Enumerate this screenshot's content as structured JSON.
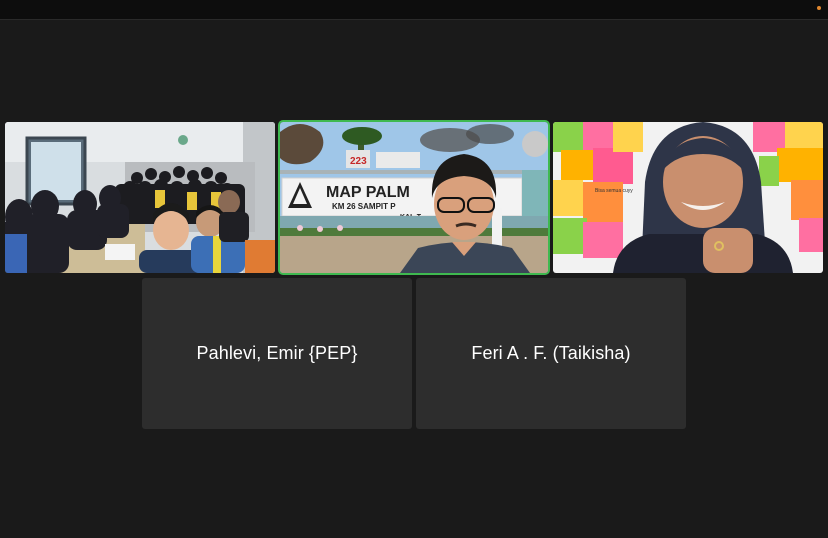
{
  "window": {
    "recording_indicator_color": "#e0872f"
  },
  "participants": [
    {
      "type": "video",
      "description_icon": "group-video-icon"
    },
    {
      "type": "video",
      "active_speaker": true,
      "sign_text_1": "MAP PALM",
      "sign_text_2": "KM 26 SAMPIT P",
      "sign_text_3": "KAL-T",
      "badge_number": "223"
    },
    {
      "type": "video",
      "note_text": "Bisa semua cuyy"
    },
    {
      "type": "name",
      "name": "Pahlevi, Emir {PEP}"
    },
    {
      "type": "name",
      "name": "Feri A . F. (Taikisha)"
    }
  ],
  "colors": {
    "active_speaker_border": "#3fb950",
    "tile_bg": "#2d2d2d",
    "stage_bg": "#1a1a1a"
  }
}
